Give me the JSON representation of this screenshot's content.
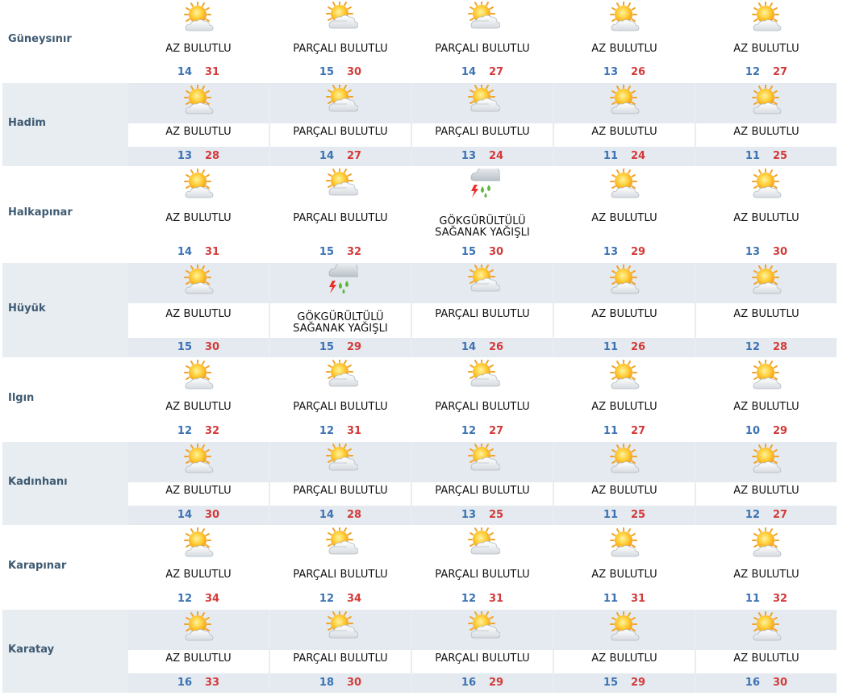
{
  "colors": {
    "min_temp": "#3a72b5",
    "max_temp": "#d43a3a",
    "row_alt_bg": "#e7edf1",
    "city_text": "#3f5b73"
  },
  "rows": [
    {
      "city": "Güneysınır",
      "days": [
        {
          "icon": "sun-cloud-icon",
          "condition": [
            "AZ BULUTLU"
          ],
          "min": "14",
          "max": "31"
        },
        {
          "icon": "cloud-sun-icon",
          "condition": [
            "PARÇALI BULUTLU"
          ],
          "min": "15",
          "max": "30"
        },
        {
          "icon": "cloud-sun-icon",
          "condition": [
            "PARÇALI BULUTLU"
          ],
          "min": "14",
          "max": "27"
        },
        {
          "icon": "sun-cloud-icon",
          "condition": [
            "AZ BULUTLU"
          ],
          "min": "13",
          "max": "26"
        },
        {
          "icon": "sun-cloud-icon",
          "condition": [
            "AZ BULUTLU"
          ],
          "min": "12",
          "max": "27"
        }
      ]
    },
    {
      "city": "Hadim",
      "days": [
        {
          "icon": "sun-cloud-icon",
          "condition": [
            "AZ BULUTLU"
          ],
          "min": "13",
          "max": "28"
        },
        {
          "icon": "cloud-sun-icon",
          "condition": [
            "PARÇALI BULUTLU"
          ],
          "min": "14",
          "max": "27"
        },
        {
          "icon": "cloud-sun-icon",
          "condition": [
            "PARÇALI BULUTLU"
          ],
          "min": "13",
          "max": "24"
        },
        {
          "icon": "sun-cloud-icon",
          "condition": [
            "AZ BULUTLU"
          ],
          "min": "11",
          "max": "24"
        },
        {
          "icon": "sun-cloud-icon",
          "condition": [
            "AZ BULUTLU"
          ],
          "min": "11",
          "max": "25"
        }
      ]
    },
    {
      "city": "Halkapınar",
      "days": [
        {
          "icon": "sun-cloud-icon",
          "condition": [
            "AZ BULUTLU"
          ],
          "min": "14",
          "max": "31"
        },
        {
          "icon": "cloud-sun-icon",
          "condition": [
            "PARÇALI BULUTLU"
          ],
          "min": "15",
          "max": "32"
        },
        {
          "icon": "thunderstorm-icon",
          "condition": [
            "GÖKGÜRÜLTÜLÜ",
            "SAĞANAK YAĞIŞLI"
          ],
          "min": "15",
          "max": "30"
        },
        {
          "icon": "sun-cloud-icon",
          "condition": [
            "AZ BULUTLU"
          ],
          "min": "13",
          "max": "29"
        },
        {
          "icon": "sun-cloud-icon",
          "condition": [
            "AZ BULUTLU"
          ],
          "min": "13",
          "max": "30"
        }
      ]
    },
    {
      "city": "Hüyük",
      "days": [
        {
          "icon": "sun-cloud-icon",
          "condition": [
            "AZ BULUTLU"
          ],
          "min": "15",
          "max": "30"
        },
        {
          "icon": "thunderstorm-icon",
          "condition": [
            "GÖKGÜRÜLTÜLÜ",
            "SAĞANAK YAĞIŞLI"
          ],
          "min": "15",
          "max": "29"
        },
        {
          "icon": "cloud-sun-icon",
          "condition": [
            "PARÇALI BULUTLU"
          ],
          "min": "14",
          "max": "26"
        },
        {
          "icon": "sun-cloud-icon",
          "condition": [
            "AZ BULUTLU"
          ],
          "min": "11",
          "max": "26"
        },
        {
          "icon": "sun-cloud-icon",
          "condition": [
            "AZ BULUTLU"
          ],
          "min": "12",
          "max": "28"
        }
      ]
    },
    {
      "city": "Ilgın",
      "days": [
        {
          "icon": "sun-cloud-icon",
          "condition": [
            "AZ BULUTLU"
          ],
          "min": "12",
          "max": "32"
        },
        {
          "icon": "cloud-sun-icon",
          "condition": [
            "PARÇALI BULUTLU"
          ],
          "min": "12",
          "max": "31"
        },
        {
          "icon": "cloud-sun-icon",
          "condition": [
            "PARÇALI BULUTLU"
          ],
          "min": "12",
          "max": "27"
        },
        {
          "icon": "sun-cloud-icon",
          "condition": [
            "AZ BULUTLU"
          ],
          "min": "11",
          "max": "27"
        },
        {
          "icon": "sun-cloud-icon",
          "condition": [
            "AZ BULUTLU"
          ],
          "min": "10",
          "max": "29"
        }
      ]
    },
    {
      "city": "Kadınhanı",
      "days": [
        {
          "icon": "sun-cloud-icon",
          "condition": [
            "AZ BULUTLU"
          ],
          "min": "14",
          "max": "30"
        },
        {
          "icon": "cloud-sun-icon",
          "condition": [
            "PARÇALI BULUTLU"
          ],
          "min": "14",
          "max": "28"
        },
        {
          "icon": "cloud-sun-icon",
          "condition": [
            "PARÇALI BULUTLU"
          ],
          "min": "13",
          "max": "25"
        },
        {
          "icon": "sun-cloud-icon",
          "condition": [
            "AZ BULUTLU"
          ],
          "min": "11",
          "max": "25"
        },
        {
          "icon": "sun-cloud-icon",
          "condition": [
            "AZ BULUTLU"
          ],
          "min": "12",
          "max": "27"
        }
      ]
    },
    {
      "city": "Karapınar",
      "days": [
        {
          "icon": "sun-cloud-icon",
          "condition": [
            "AZ BULUTLU"
          ],
          "min": "12",
          "max": "34"
        },
        {
          "icon": "cloud-sun-icon",
          "condition": [
            "PARÇALI BULUTLU"
          ],
          "min": "12",
          "max": "34"
        },
        {
          "icon": "cloud-sun-icon",
          "condition": [
            "PARÇALI BULUTLU"
          ],
          "min": "12",
          "max": "31"
        },
        {
          "icon": "sun-cloud-icon",
          "condition": [
            "AZ BULUTLU"
          ],
          "min": "11",
          "max": "31"
        },
        {
          "icon": "sun-cloud-icon",
          "condition": [
            "AZ BULUTLU"
          ],
          "min": "11",
          "max": "32"
        }
      ]
    },
    {
      "city": "Karatay",
      "days": [
        {
          "icon": "sun-cloud-icon",
          "condition": [
            "AZ BULUTLU"
          ],
          "min": "16",
          "max": "33"
        },
        {
          "icon": "cloud-sun-icon",
          "condition": [
            "PARÇALI BULUTLU"
          ],
          "min": "18",
          "max": "30"
        },
        {
          "icon": "cloud-sun-icon",
          "condition": [
            "PARÇALI BULUTLU"
          ],
          "min": "16",
          "max": "29"
        },
        {
          "icon": "sun-cloud-icon",
          "condition": [
            "AZ BULUTLU"
          ],
          "min": "15",
          "max": "29"
        },
        {
          "icon": "sun-cloud-icon",
          "condition": [
            "AZ BULUTLU"
          ],
          "min": "16",
          "max": "30"
        }
      ]
    }
  ]
}
